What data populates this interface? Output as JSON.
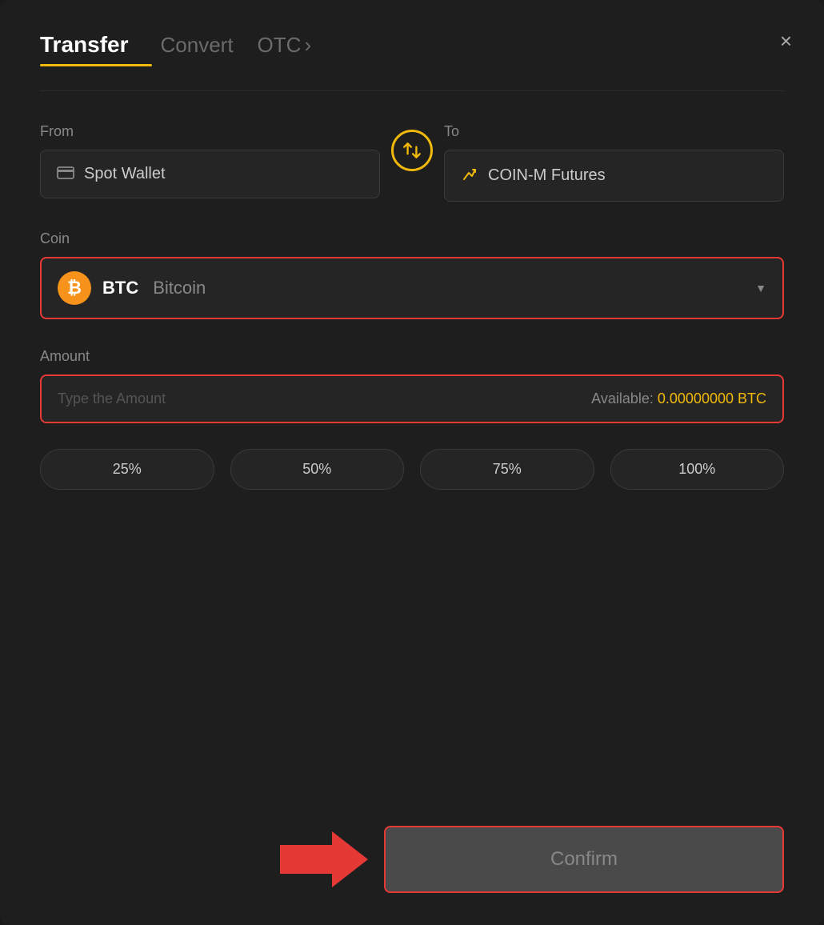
{
  "header": {
    "tab_transfer": "Transfer",
    "tab_convert": "Convert",
    "tab_otc": "OTC",
    "otc_chevron": "›",
    "close_label": "×"
  },
  "from_section": {
    "label": "From",
    "wallet_name": "Spot Wallet"
  },
  "to_section": {
    "label": "To",
    "wallet_name": "COIN-M Futures"
  },
  "coin_section": {
    "label": "Coin",
    "coin_symbol": "BTC",
    "coin_name": "Bitcoin",
    "chevron": "▼"
  },
  "amount_section": {
    "label": "Amount",
    "placeholder": "Type the Amount",
    "available_label": "Available:",
    "available_value": "0.00000000 BTC"
  },
  "percent_buttons": [
    {
      "label": "25%"
    },
    {
      "label": "50%"
    },
    {
      "label": "75%"
    },
    {
      "label": "100%"
    }
  ],
  "confirm_button": {
    "label": "Confirm"
  }
}
